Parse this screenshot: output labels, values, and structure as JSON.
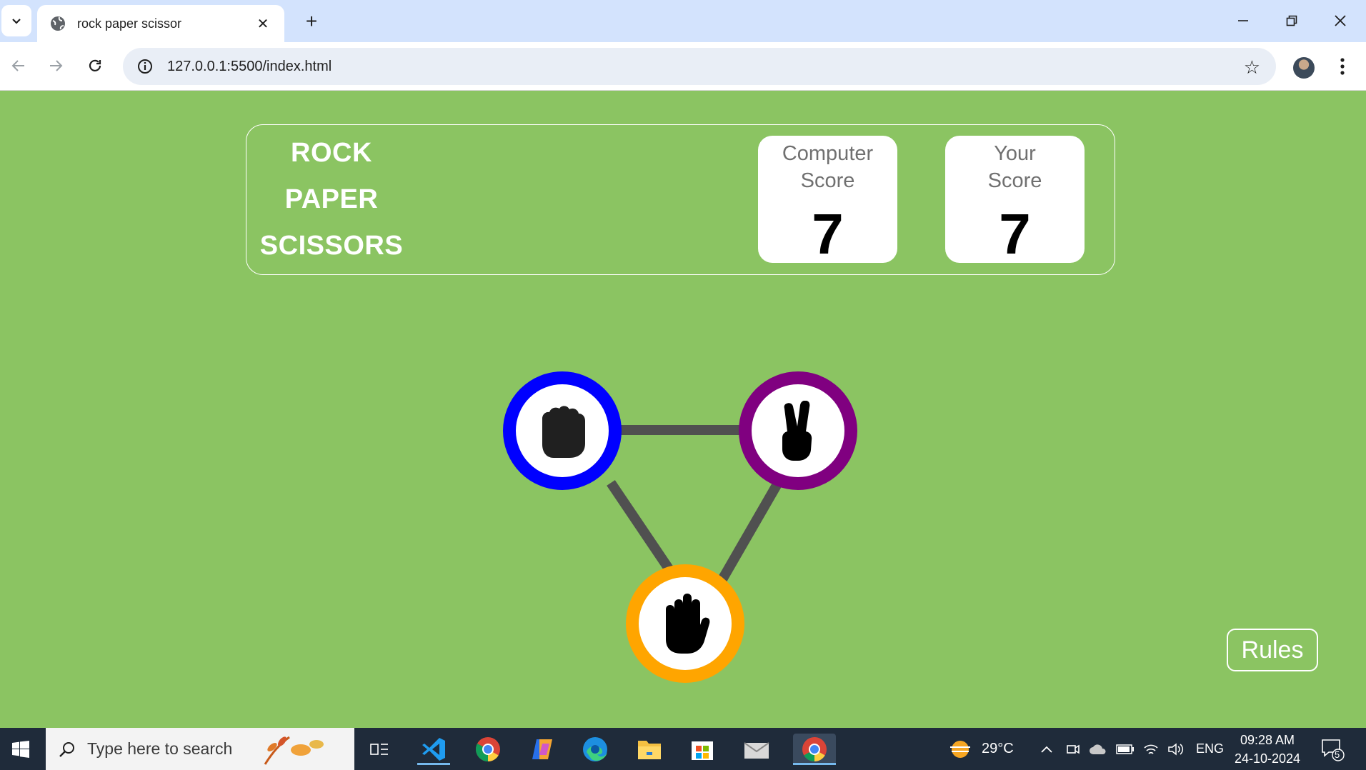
{
  "browser": {
    "tab_title": "rock paper scissor",
    "url": "127.0.0.1:5500/index.html",
    "new_tab_symbol": "+",
    "close_tab_symbol": "✕"
  },
  "game": {
    "title_lines": [
      "ROCK",
      "PAPER",
      "SCISSORS"
    ],
    "computer_score_label": "Computer\nScore",
    "computer_score": "7",
    "your_score_label": "Your\nScore",
    "your_score": "7",
    "rules_label": "Rules",
    "choices": [
      {
        "name": "rock",
        "ring_color": "#0000ff",
        "icon": "fist-icon"
      },
      {
        "name": "scissors",
        "ring_color": "#800080",
        "icon": "peace-hand-icon"
      },
      {
        "name": "paper",
        "ring_color": "#ffa500",
        "icon": "open-hand-icon"
      }
    ]
  },
  "taskbar": {
    "search_placeholder": "Type here to search",
    "weather": "29°C",
    "language": "ENG",
    "time": "09:28 AM",
    "date": "24-10-2024",
    "notification_count": "5"
  },
  "colors": {
    "page_bg": "#8bc462",
    "tabstrip_bg": "#d3e3fd",
    "taskbar_bg": "#1f2b3a",
    "connector": "#505050"
  }
}
